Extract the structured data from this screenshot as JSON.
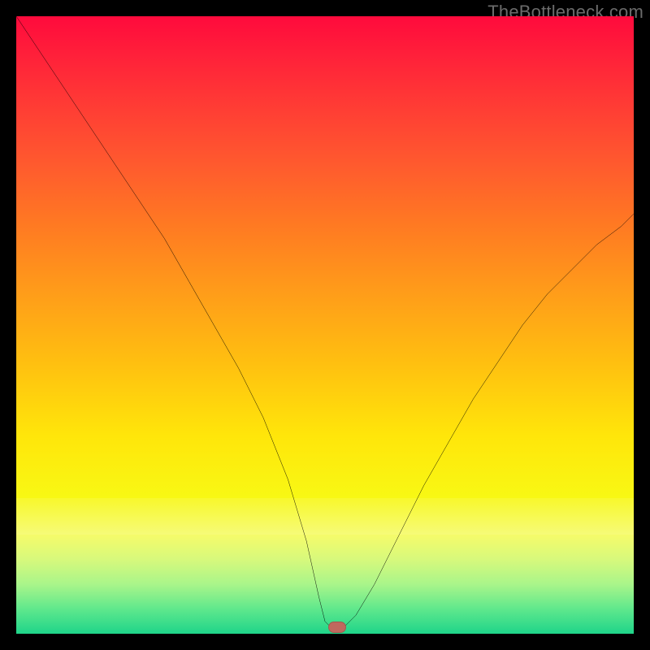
{
  "watermark_text": "TheBottleneck.com",
  "chart_data": {
    "type": "line",
    "title": "",
    "xlabel": "",
    "ylabel": "",
    "xlim": [
      0,
      100
    ],
    "ylim": [
      0,
      100
    ],
    "gradient": {
      "top_color": "#ff0a3c",
      "mid_color": "#ffe60a",
      "bottom_color": "#1fd48a"
    },
    "marker": {
      "x": 52,
      "y": 1,
      "color": "#c0695e"
    },
    "series": [
      {
        "name": "bottleneck-curve",
        "x": [
          0,
          4,
          8,
          12,
          16,
          20,
          24,
          28,
          32,
          36,
          40,
          44,
          47,
          49,
          50,
          51,
          53,
          55,
          58,
          62,
          66,
          70,
          74,
          78,
          82,
          86,
          90,
          94,
          98,
          100
        ],
        "y": [
          100,
          94,
          88,
          82,
          76,
          70,
          64,
          57,
          50,
          43,
          35,
          25,
          15,
          6,
          2,
          1,
          1,
          3,
          8,
          16,
          24,
          31,
          38,
          44,
          50,
          55,
          59,
          63,
          66,
          68
        ]
      }
    ]
  }
}
